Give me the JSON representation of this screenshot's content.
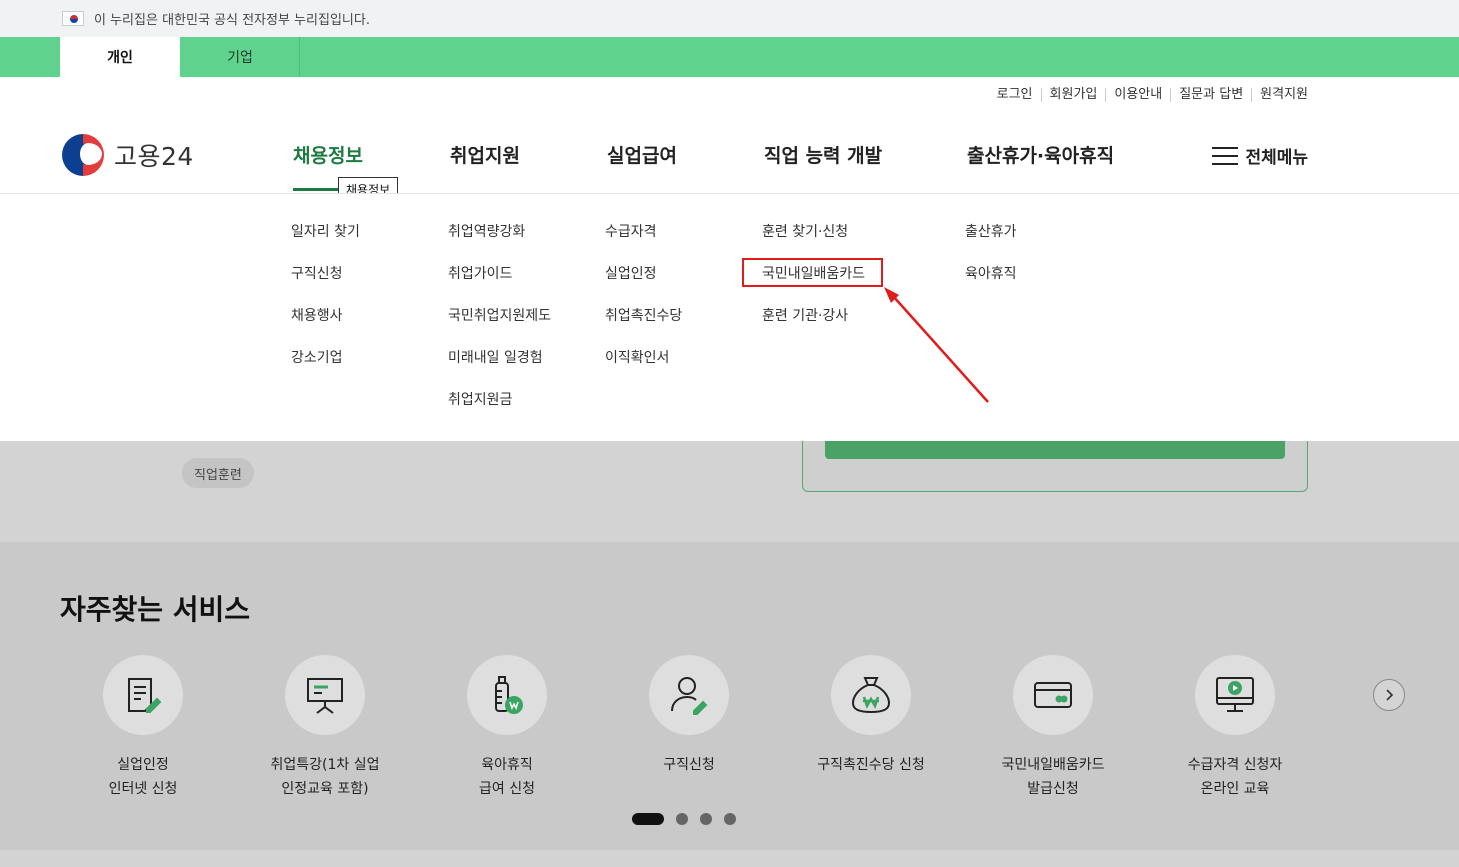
{
  "gov_banner": {
    "text": "이 누리집은 대한민국 공식 전자정부 누리집입니다."
  },
  "tabs": [
    {
      "label": "개인"
    },
    {
      "label": "기업"
    }
  ],
  "util_links": [
    "로그인",
    "회원가입",
    "이용안내",
    "질문과 답변",
    "원격지원"
  ],
  "logo": {
    "text": "고용24"
  },
  "gnb": [
    "채용정보",
    "취업지원",
    "실업급여",
    "직업 능력 개발",
    "출산휴가·육아휴직"
  ],
  "tooltip": "채용정보",
  "all_menu": "전체메뉴",
  "submenu": {
    "col1": [
      "일자리 찾기",
      "구직신청",
      "채용행사",
      "강소기업"
    ],
    "col2": [
      "취업역량강화",
      "취업가이드",
      "국민취업지원제도",
      "미래내일 일경험",
      "취업지원금"
    ],
    "col3": [
      "수급자격",
      "실업인정",
      "취업촉진수당",
      "이직확인서"
    ],
    "col4": [
      "훈련 찾기·신청",
      "국민내일배움카드",
      "훈련 기관·강사"
    ],
    "col5": [
      "출산휴가",
      "육아휴직"
    ]
  },
  "chip": "직업훈련",
  "services_title": "자주찾는 서비스",
  "services": [
    {
      "label": "실업인정\n인터넷 신청",
      "icon": "document-pen-icon"
    },
    {
      "label": "취업특강(1차 실업\n인정교육 포함)",
      "icon": "presentation-board-icon"
    },
    {
      "label": "육아휴직\n급여 신청",
      "icon": "baby-bottle-won-icon"
    },
    {
      "label": "구직신청",
      "icon": "person-pen-icon"
    },
    {
      "label": "구직촉진수당 신청",
      "icon": "money-bag-won-icon"
    },
    {
      "label": "국민내일배움카드\n발급신청",
      "icon": "card-icon"
    },
    {
      "label": "수급자격 신청자\n온라인 교육",
      "icon": "monitor-play-icon"
    }
  ],
  "carousel": {
    "pages": 4,
    "current": 1
  },
  "colors": {
    "green_bar": "#5fd38d",
    "brand_green": "#1e7a40",
    "highlight": "#e01c1c"
  }
}
